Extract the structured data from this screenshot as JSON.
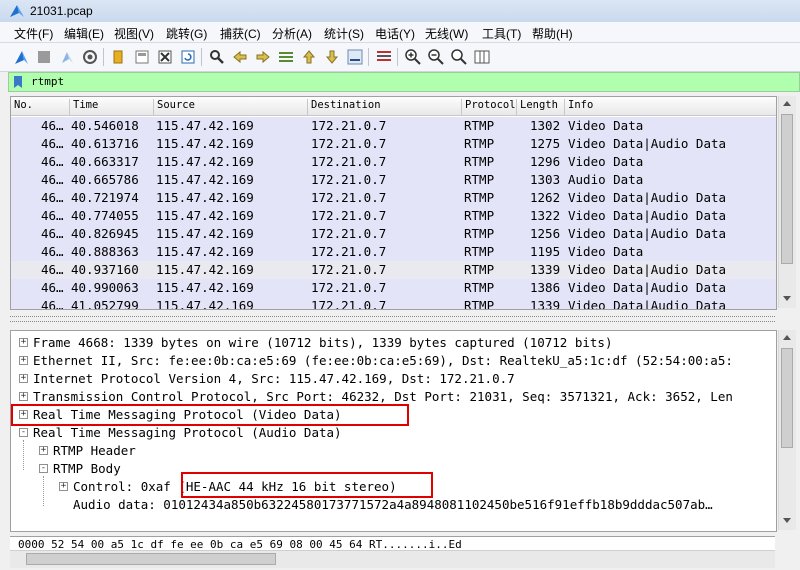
{
  "window": {
    "title": "21031.pcap"
  },
  "menu": [
    "文件(F)",
    "编辑(E)",
    "视图(V)",
    "跳转(G)",
    "捕获(C)",
    "分析(A)",
    "统计(S)",
    "电话(Y)",
    "无线(W)",
    "工具(T)",
    "帮助(H)"
  ],
  "filter": {
    "value": "rtmpt"
  },
  "columns": [
    "No.",
    "Time",
    "Source",
    "Destination",
    "Protocol",
    "Length",
    "Info"
  ],
  "packets": [
    {
      "no": "46…",
      "time": "40.546018",
      "src": "115.47.42.169",
      "dst": "172.21.0.7",
      "proto": "RTMP",
      "len": "1302",
      "info": "Video Data"
    },
    {
      "no": "46…",
      "time": "40.613716",
      "src": "115.47.42.169",
      "dst": "172.21.0.7",
      "proto": "RTMP",
      "len": "1275",
      "info": "Video Data|Audio Data"
    },
    {
      "no": "46…",
      "time": "40.663317",
      "src": "115.47.42.169",
      "dst": "172.21.0.7",
      "proto": "RTMP",
      "len": "1296",
      "info": "Video Data"
    },
    {
      "no": "46…",
      "time": "40.665786",
      "src": "115.47.42.169",
      "dst": "172.21.0.7",
      "proto": "RTMP",
      "len": "1303",
      "info": "Audio Data"
    },
    {
      "no": "46…",
      "time": "40.721974",
      "src": "115.47.42.169",
      "dst": "172.21.0.7",
      "proto": "RTMP",
      "len": "1262",
      "info": "Video Data|Audio Data"
    },
    {
      "no": "46…",
      "time": "40.774055",
      "src": "115.47.42.169",
      "dst": "172.21.0.7",
      "proto": "RTMP",
      "len": "1322",
      "info": "Video Data|Audio Data"
    },
    {
      "no": "46…",
      "time": "40.826945",
      "src": "115.47.42.169",
      "dst": "172.21.0.7",
      "proto": "RTMP",
      "len": "1256",
      "info": "Video Data|Audio Data"
    },
    {
      "no": "46…",
      "time": "40.888363",
      "src": "115.47.42.169",
      "dst": "172.21.0.7",
      "proto": "RTMP",
      "len": "1195",
      "info": "Video Data"
    },
    {
      "no": "46…",
      "time": "40.937160",
      "src": "115.47.42.169",
      "dst": "172.21.0.7",
      "proto": "RTMP",
      "len": "1339",
      "info": "Video Data|Audio Data"
    },
    {
      "no": "46…",
      "time": "40.990063",
      "src": "115.47.42.169",
      "dst": "172.21.0.7",
      "proto": "RTMP",
      "len": "1386",
      "info": "Video Data|Audio Data"
    },
    {
      "no": "46…",
      "time": "41.052799",
      "src": "115.47.42.169",
      "dst": "172.21.0.7",
      "proto": "RTMP",
      "len": "1339",
      "info": "Video Data|Audio Data"
    }
  ],
  "details": [
    {
      "text": "Frame 4668: 1339 bytes on wire (10712 bits), 1339 bytes captured (10712 bits)",
      "exp": "+"
    },
    {
      "text": "Ethernet II, Src: fe:ee:0b:ca:e5:69 (fe:ee:0b:ca:e5:69), Dst: RealtekU_a5:1c:df (52:54:00:a5:",
      "exp": "+"
    },
    {
      "text": "Internet Protocol Version 4, Src: 115.47.42.169, Dst: 172.21.0.7",
      "exp": "+"
    },
    {
      "text": "Transmission Control Protocol, Src Port: 46232, Dst Port: 21031, Seq: 3571321, Ack: 3652, Len",
      "exp": "+"
    },
    {
      "text": "Real Time Messaging Protocol (Video Data)",
      "exp": "+"
    },
    {
      "text": "Real Time Messaging Protocol (Audio Data)",
      "exp": "−"
    },
    {
      "text": "RTMP Header",
      "exp": "+"
    },
    {
      "text": "RTMP Body",
      "exp": "−"
    },
    {
      "text": "Control: 0xaf (HE-AAC 44 kHz 16 bit stereo)",
      "exp": "+"
    },
    {
      "text": "Audio data: 01012434a850b63224580173771572a4a8948081102450be516f91effb18b9dddac507ab…",
      "exp": ""
    }
  ],
  "hex": {
    "line": "0000  52 54 00 a5 1c df fe ee  0b ca e5 69 08 00 45 64   RT.......i..Ed"
  },
  "colors": {
    "filter_bg": "#afffaf",
    "packet_row_bg": "#e4e4f8",
    "highlight": "#e00000"
  }
}
